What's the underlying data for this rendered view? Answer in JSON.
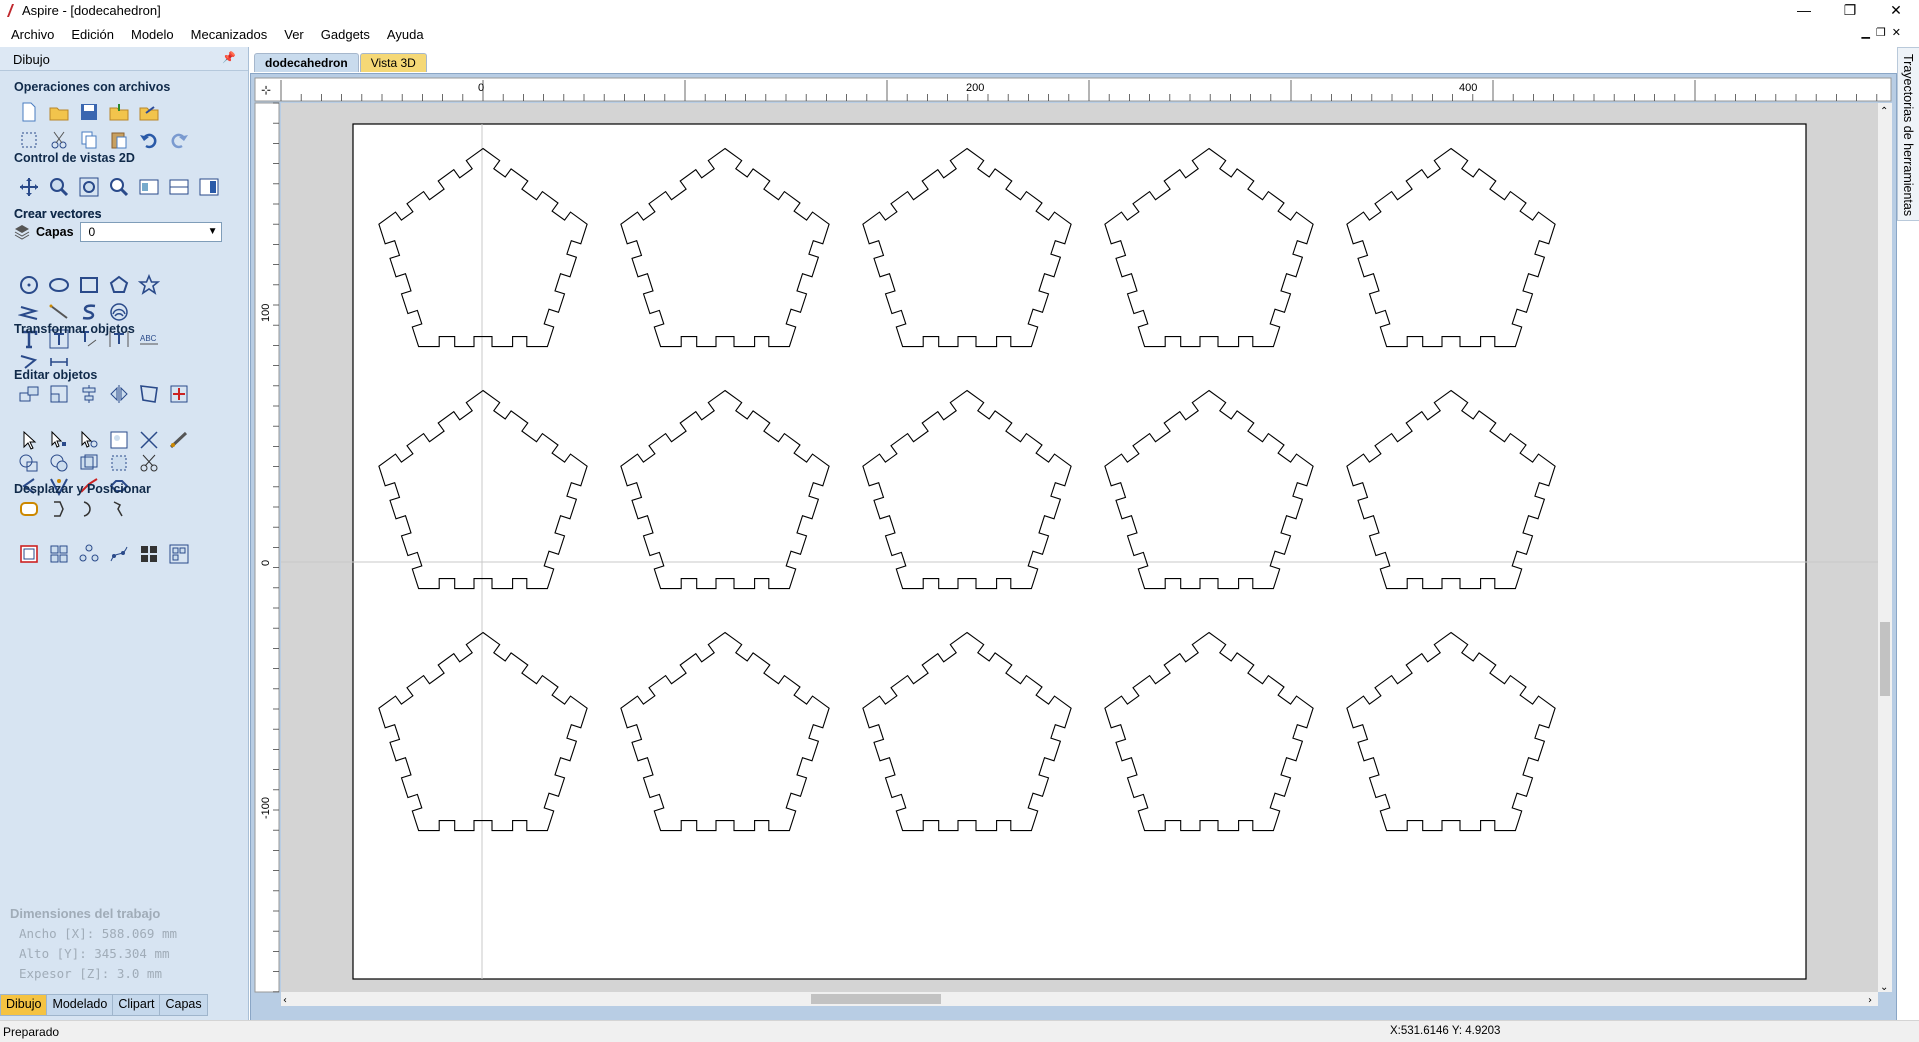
{
  "window": {
    "title": "Aspire - [dodecahedron]",
    "minimize": "—",
    "maximize": "❐",
    "close": "✕"
  },
  "menu": [
    "Archivo",
    "Edición",
    "Modelo",
    "Mecanizados",
    "Ver",
    "Gadgets",
    "Ayuda"
  ],
  "panel": {
    "title": "Dibujo",
    "sections": {
      "files": "Operaciones con archivos",
      "views": "Control de vistas 2D",
      "vectors": "Crear vectores",
      "transform": "Transformar objetos",
      "edit": "Editar objetos",
      "position": "Desplazar y Posicionar"
    },
    "layers_label": "Capas",
    "layer_value": "0"
  },
  "job": {
    "title": "Dimensiones del trabajo",
    "width": "Ancho   [X]: 588.069 mm",
    "height": "Alto   [Y]: 345.304 mm",
    "thickness": "Expesor [Z]: 3.0 mm"
  },
  "bottom_tabs": [
    "Dibujo",
    "Modelado",
    "Clipart",
    "Capas"
  ],
  "doc_tabs": [
    "dodecahedron",
    "Vista 3D"
  ],
  "side_tab": "Trayectorias de herramientas",
  "rulers": {
    "top": [
      "0",
      "200",
      "400"
    ],
    "left": [
      "100",
      "0",
      "-100"
    ]
  },
  "status": {
    "left": "Preparado",
    "coords": "X:531.6146 Y: 4.9203"
  },
  "colors": {
    "panel": "#d7e4f2",
    "accent": "#f5c342",
    "frame": "#b8cde4"
  }
}
